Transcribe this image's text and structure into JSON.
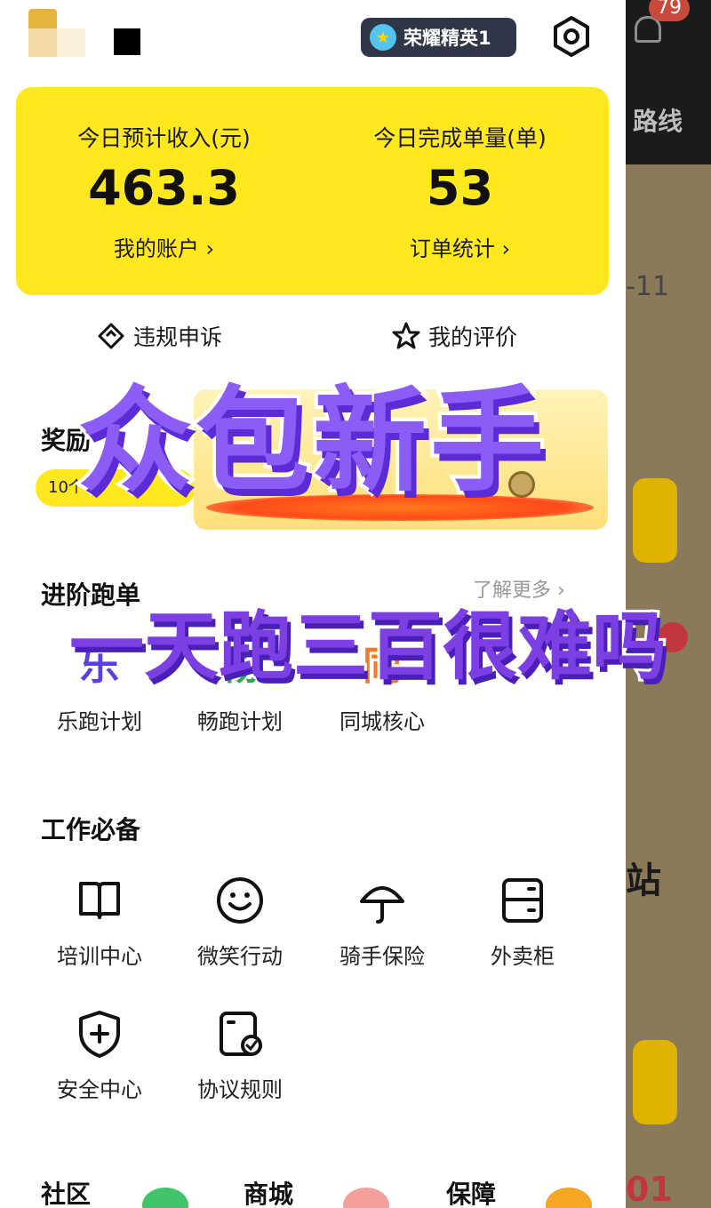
{
  "background_app": {
    "notification_count": "79",
    "route_label": "路线",
    "date_fragment": "-11",
    "station_fragment": "站",
    "bottom_fragment": "01"
  },
  "header": {
    "rank_badge": "荣耀精英1"
  },
  "stats": {
    "income_label": "今日预计收入(元)",
    "income_value": "463.3",
    "income_link": "我的账户 ›",
    "orders_label": "今日完成单量(单)",
    "orders_value": "53",
    "orders_link": "订单统计 ›"
  },
  "quick_actions": {
    "appeal": "违规申诉",
    "rating": "我的评价"
  },
  "rewards": {
    "title": "奖励",
    "pill": "10个"
  },
  "advanced": {
    "title": "进阶跑单",
    "learn_more": "了解更多 ›",
    "items": [
      {
        "glyph": "乐",
        "label": "乐跑计划",
        "color": "#5b3fe0"
      },
      {
        "glyph": "畅",
        "label": "畅跑计划",
        "color": "#2fa84f"
      },
      {
        "glyph": "同",
        "label": "同城核心",
        "color": "#f07a2a"
      }
    ]
  },
  "work_essentials": {
    "title": "工作必备",
    "items": [
      {
        "label": "培训中心",
        "icon": "book-icon"
      },
      {
        "label": "微笑行动",
        "icon": "smile-icon"
      },
      {
        "label": "骑手保险",
        "icon": "umbrella-icon"
      },
      {
        "label": "外卖柜",
        "icon": "locker-icon"
      },
      {
        "label": "安全中心",
        "icon": "shield-icon"
      },
      {
        "label": "协议规则",
        "icon": "document-check-icon"
      }
    ]
  },
  "bottom_tabs": {
    "community": "社区",
    "mall": "商城",
    "protection": "保障"
  },
  "overlay": {
    "title": "众包新手",
    "subtitle": "一天跑三百很难吗"
  },
  "colors": {
    "accent_yellow": "#ffe81e",
    "overlay_purple": "#8b5cf6",
    "rank_badge_bg": "#2e3647"
  }
}
